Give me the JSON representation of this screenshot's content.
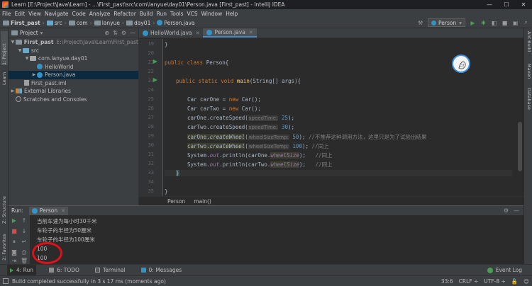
{
  "window": {
    "title": "Learn [E:\\Project\\Java\\Learn] - ...\\First_past\\src\\com\\lanyue\\day01\\Person.java [First_past] - IntelliJ IDEA",
    "controls": [
      "—",
      "☐",
      "✕"
    ]
  },
  "menu": [
    "File",
    "Edit",
    "View",
    "Navigate",
    "Code",
    "Analyze",
    "Refactor",
    "Build",
    "Run",
    "Tools",
    "VCS",
    "Window",
    "Help"
  ],
  "breadcrumb": [
    "First_past",
    "src",
    "com",
    "lanyue",
    "day01",
    "Person.java"
  ],
  "toolbar": {
    "run_config": "Person"
  },
  "left_strip": {
    "project": "1: Project",
    "learn": "Learn",
    "structure": "Z: Structure",
    "favorites": "2: Favorites"
  },
  "right_strip": {
    "ant": "Ant Build",
    "maven": "Maven",
    "database": "Database"
  },
  "project_panel": {
    "title": "Project",
    "tree": [
      {
        "label": "First_past",
        "path": "E:\\Project\\Java\\Learn\\First_past"
      },
      {
        "label": "src"
      },
      {
        "label": "com.lanyue.day01"
      },
      {
        "label": "HelloWorld"
      },
      {
        "label": "Person.java"
      },
      {
        "label": "First_past.iml"
      },
      {
        "label": "External Libraries"
      },
      {
        "label": "Scratches and Consoles"
      }
    ]
  },
  "editor": {
    "tabs": [
      {
        "label": "HelloWorld.java"
      },
      {
        "label": "Person.java"
      }
    ],
    "line_numbers": [
      "19",
      "20",
      "21",
      "22",
      "23",
      "24",
      "25",
      "26",
      "27",
      "28",
      "29",
      "30",
      "31",
      "32",
      "33",
      "34",
      "35",
      "36"
    ],
    "code": {
      "l19": "}",
      "l21_kw": "public class",
      "l21_name": " Person{",
      "l23_kw": "public static void",
      "l23_fn": "main",
      "l23_rest": "(String[] args){",
      "l25_a": "Car carOne = ",
      "l25_kw": "new",
      "l25_b": " Car();",
      "l26_a": "Car carTwo = ",
      "l26_kw": "new",
      "l26_b": " Car();",
      "l27_a": "carOne.createSpeed(",
      "l27_hint": "speedTime:",
      "l27_num": "25",
      "l27_b": ");",
      "l28_a": "carTwo.createSpeed(",
      "l28_hint": "speedTime:",
      "l28_num": "30",
      "l28_b": ");",
      "l29_a": "carOne.",
      "l29_m": "createWheel",
      "l29_b": "(",
      "l29_hint": "wheelSizeTemp:",
      "l29_num": "50",
      "l29_c": ");",
      "l29_cmt": "//不推荐这种调用方法，这里只是为了试验出结果",
      "l30_a": "carTwo.",
      "l30_m": "createWheel",
      "l30_b": "(",
      "l30_hint": "wheelSizeTemp:",
      "l30_num": "100",
      "l30_c": ");",
      "l30_cmt": "//同上",
      "l31_a": "System.",
      "l31_f": "out",
      "l31_b": ".println(carOne.",
      "l31_f2": "wheelSize",
      "l31_c": ");",
      "l31_cmt": "//同上",
      "l32_a": "System.",
      "l32_f": "out",
      "l32_b": ".println(carTwo.",
      "l32_f2": "wheelSize",
      "l32_c": ");",
      "l32_cmt": "//同上",
      "l33": "}",
      "l35": "}"
    },
    "breadcrumb": [
      "Person",
      "main()"
    ]
  },
  "run_panel": {
    "label": "Run:",
    "tab": "Person",
    "output": [
      "当前车速为每小时30千米",
      "车轮子的半径为50厘米",
      "车轮子的半径为100厘米",
      "100",
      "100"
    ]
  },
  "bottom_tabs": [
    "4: Run",
    "6: TODO",
    "Terminal",
    "0: Messages"
  ],
  "event_log": "Event Log",
  "status": {
    "message": "Build completed successfully in 3 s 17 ms (moments ago)",
    "position": "33:6",
    "line_sep": "CRLF ÷",
    "encoding": "UTF-8 ÷"
  },
  "colors": {
    "accent": "#4a88c7",
    "run_green": "#499c54",
    "annotation_red": "#e0101a"
  }
}
